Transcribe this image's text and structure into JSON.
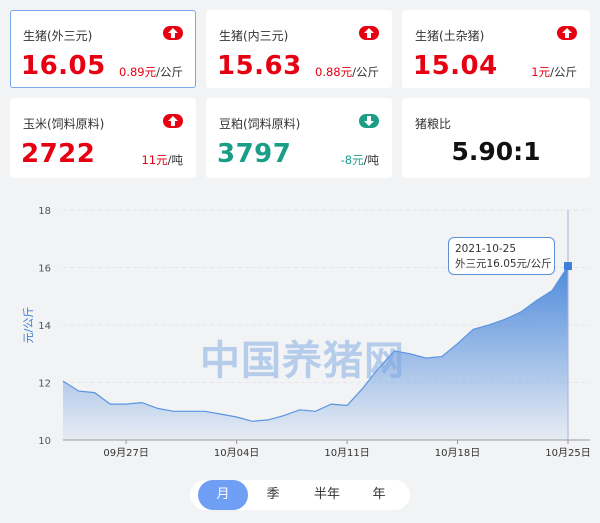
{
  "cards": [
    {
      "name": "生猪(外三元)",
      "price": "16.05",
      "change": "0.89元",
      "unit": "/公斤",
      "direction": "up"
    },
    {
      "name": "生猪(内三元)",
      "price": "15.63",
      "change": "0.88元",
      "unit": "/公斤",
      "direction": "up"
    },
    {
      "name": "生猪(土杂猪)",
      "price": "15.04",
      "change": "1元",
      "unit": "/公斤",
      "direction": "up"
    },
    {
      "name": "玉米(饲料原料)",
      "price": "2722",
      "change": "11元",
      "unit": "/吨",
      "direction": "up"
    },
    {
      "name": "豆粕(饲料原料)",
      "price": "3797",
      "change": "-8元",
      "unit": "/吨",
      "direction": "down"
    },
    {
      "name": "猪粮比",
      "value": "5.90:1"
    }
  ],
  "colors": {
    "up": "#e60012",
    "down": "#1a9e86",
    "accent": "#3d7fd9",
    "tab_active": "#6f9ef5"
  },
  "chart_data": {
    "type": "area",
    "ylabel": "元/公斤",
    "ylim": [
      10,
      18
    ],
    "yticks": [
      10,
      12,
      14,
      16,
      18
    ],
    "xticks": [
      "09月27日",
      "10月04日",
      "10月11日",
      "10月18日",
      "10月25日"
    ],
    "grid": "horizontal dashed",
    "series": [
      {
        "x": [
          "2021-09-23",
          "2021-09-24",
          "2021-09-25",
          "2021-09-26",
          "2021-09-27",
          "2021-09-28",
          "2021-09-29",
          "2021-09-30",
          "2021-10-01",
          "2021-10-02",
          "2021-10-03",
          "2021-10-04",
          "2021-10-05",
          "2021-10-06",
          "2021-10-07",
          "2021-10-08",
          "2021-10-09",
          "2021-10-10",
          "2021-10-11",
          "2021-10-12",
          "2021-10-13",
          "2021-10-14",
          "2021-10-15",
          "2021-10-16",
          "2021-10-17",
          "2021-10-18",
          "2021-10-19",
          "2021-10-20",
          "2021-10-21",
          "2021-10-22",
          "2021-10-23",
          "2021-10-24",
          "2021-10-25"
        ],
        "values": [
          12.05,
          11.7,
          11.65,
          11.25,
          11.25,
          11.3,
          11.1,
          11.0,
          11.0,
          11.0,
          10.9,
          10.8,
          10.65,
          10.7,
          10.85,
          11.05,
          11.0,
          11.25,
          11.2,
          11.8,
          12.5,
          13.1,
          13.0,
          12.85,
          12.9,
          13.35,
          13.85,
          14.0,
          14.2,
          14.45,
          14.85,
          15.2,
          16.05
        ]
      }
    ],
    "tooltip": {
      "date": "2021-10-25",
      "label": "外三元16.05元/公斤"
    }
  },
  "watermark": "中国养猪网",
  "periods": [
    "月",
    "季",
    "半年",
    "年"
  ],
  "active_period": 0
}
